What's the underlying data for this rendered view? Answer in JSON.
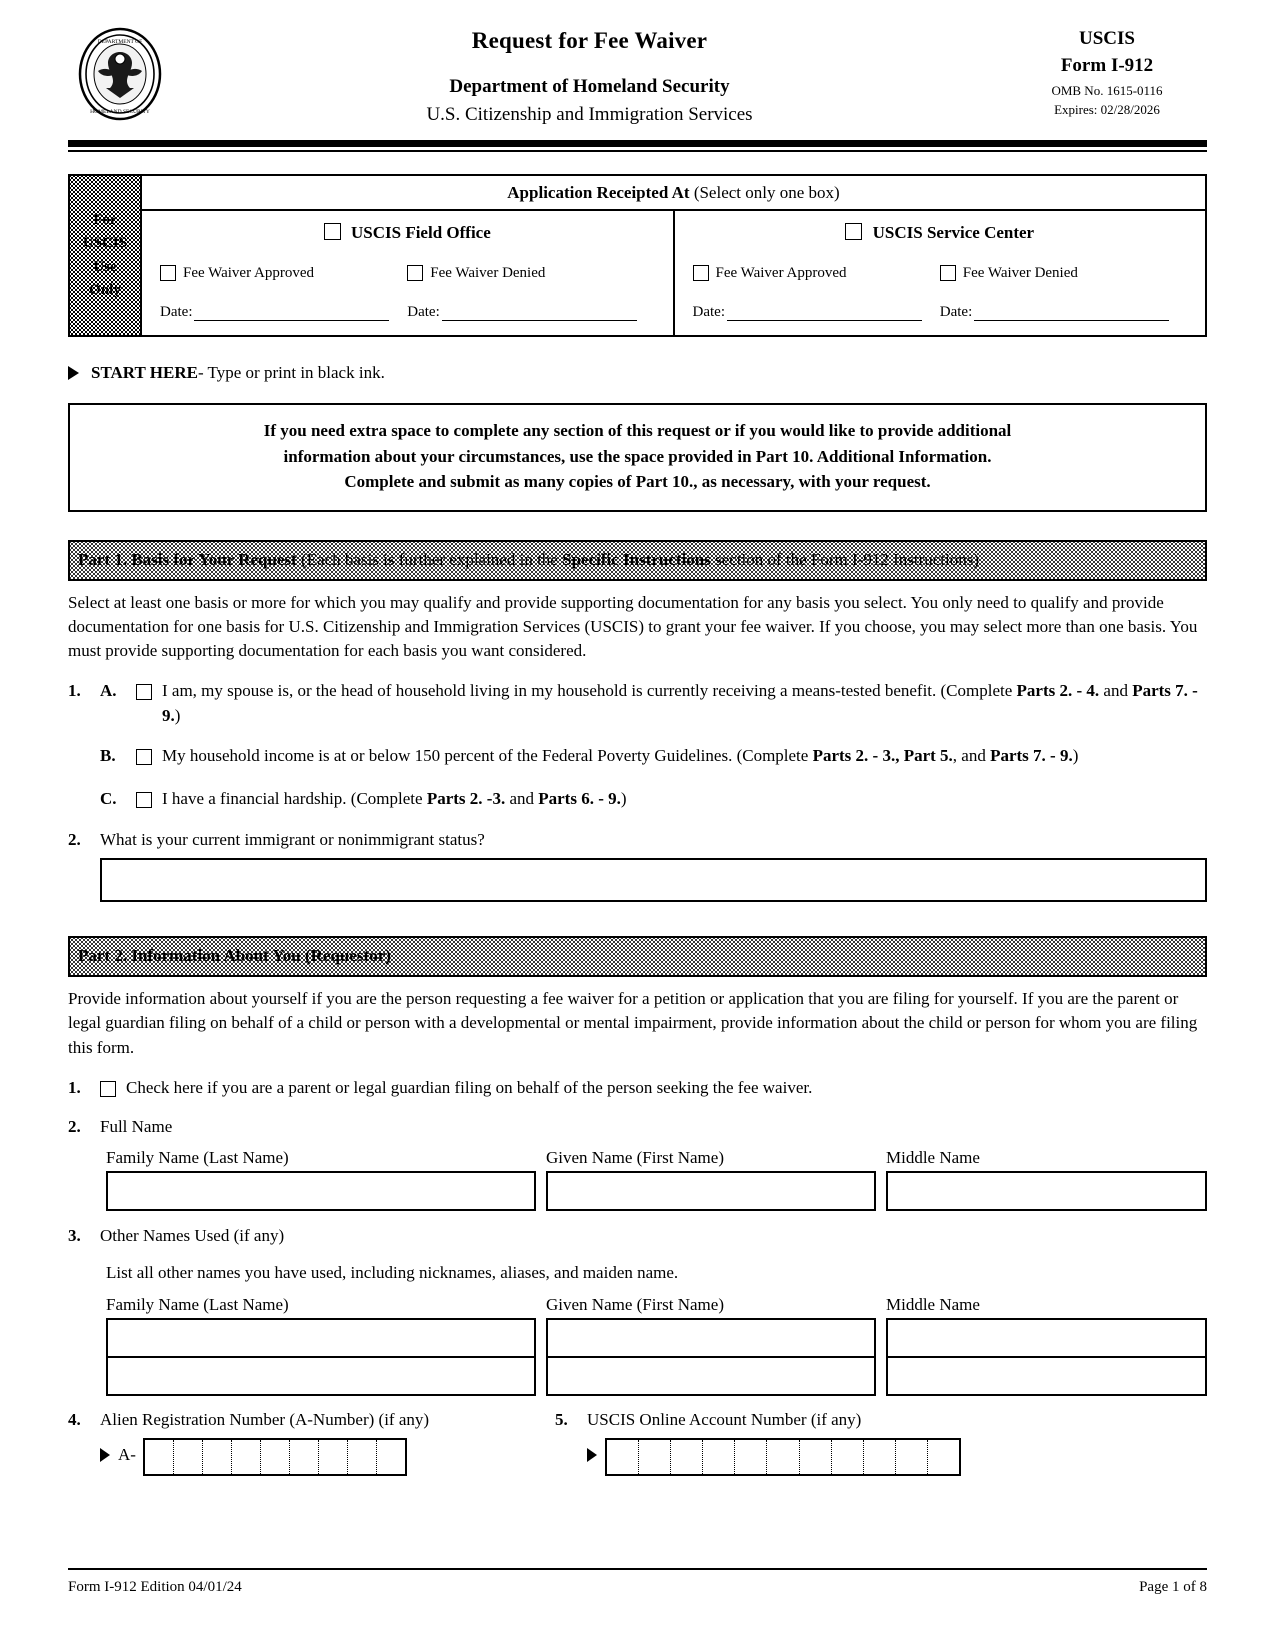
{
  "header": {
    "seal_alt": "dhs-seal",
    "title": "Request for Fee Waiver",
    "agency": "Department of Homeland Security",
    "subagency": "U.S. Citizenship and Immigration Services",
    "org": "USCIS",
    "form_number": "Form I-912",
    "omb": "OMB No. 1615-0116",
    "expires": "Expires: 02/28/2026"
  },
  "uscis_use": {
    "side_label": "For USCIS Use Only",
    "side_lines": [
      "For",
      "USCIS",
      "Use",
      "Only"
    ],
    "title_bold": "Application Receipted At",
    "title_rest": "(Select only one box)",
    "columns": [
      {
        "heading": "USCIS Field Office",
        "options": [
          "Fee Waiver Approved",
          "Fee Waiver Denied"
        ],
        "date_label": "Date:"
      },
      {
        "heading": "USCIS Service Center",
        "options": [
          "Fee Waiver Approved",
          "Fee Waiver Denied"
        ],
        "date_label": "Date:"
      }
    ]
  },
  "start_here": {
    "bold": "START HERE",
    "rest": " - Type or print in black ink."
  },
  "notice": {
    "line1": "If you need extra space to complete any section of this request or if you would like to provide additional",
    "line2": "information about your circumstances, use the space provided in Part 10. Additional Information.",
    "line3": "Complete and submit as many copies of Part 10., as necessary, with your request."
  },
  "part1": {
    "band_bold": "Part 1.  Basis for Your Request",
    "band_rest_a": " (Each basis is further explained in the ",
    "band_rest_bold": "Specific Instructions",
    "band_rest_b": " section of the Form I-912 Instructions)",
    "intro": "Select at least one basis or more for which you may qualify and provide supporting documentation for any basis you select.  You only need to qualify and provide documentation for one basis for U.S. Citizenship and Immigration Services (USCIS) to grant your fee waiver.  If you choose, you may select more than one basis.  You must provide supporting documentation for each basis you want considered.",
    "item1_number": "1.",
    "items": [
      {
        "letter": "A.",
        "text": "I am, my spouse is, or the head of household living in my household is currently receiving a means-tested benefit. (Complete ",
        "bold1": "Parts 2. - 4.",
        "mid1": " and ",
        "bold2": "Parts 7. - 9.",
        "tail": ")"
      },
      {
        "letter": "B.",
        "text": "My household income is at or below 150 percent of the Federal Poverty Guidelines.  (Complete ",
        "bold1": "Parts 2. - 3., Part 5.",
        "mid1": ", and ",
        "bold2": "Parts 7. - 9.",
        "tail": ")"
      },
      {
        "letter": "C.",
        "text": "I have a financial hardship.  (Complete ",
        "bold1": "Parts 2. -3.",
        "mid1": " and ",
        "bold2": "Parts 6. - 9.",
        "tail": ")"
      }
    ],
    "item2_number": "2.",
    "item2_label": "What is your current immigrant or nonimmigrant status?",
    "item2_value": ""
  },
  "part2": {
    "band_bold": "Part 2.  Information About You (Requestor)",
    "intro": "Provide information about yourself if you are the person requesting a fee waiver for a petition or application that you are filing for yourself.  If you are the parent or legal guardian filing on behalf of a child or person with a developmental or mental impairment, provide information about the child or person for whom you are filing this form.",
    "item1_number": "1.",
    "item1_label": "Check here if you are a parent or legal guardian filing on behalf of the person seeking the fee waiver.",
    "item2_number": "2.",
    "item2_label": "Full Name",
    "name_labels": {
      "family": "Family Name (Last Name)",
      "given": "Given Name (First Name)",
      "middle": "Middle Name"
    },
    "name_values": {
      "family": "",
      "given": "",
      "middle": ""
    },
    "item3_number": "3.",
    "item3_label": "Other Names Used (if any)",
    "item3_help": "List all other names you have used, including nicknames, aliases, and maiden name.",
    "other_names_rows": [
      {
        "family": "",
        "given": "",
        "middle": ""
      },
      {
        "family": "",
        "given": "",
        "middle": ""
      }
    ],
    "item4_number": "4.",
    "item4_label": "Alien Registration Number (A-Number) (if any)",
    "a_prefix": "A-",
    "a_number_cells": 9,
    "a_number_value": "",
    "item5_number": "5.",
    "item5_label": "USCIS Online Account Number (if any)",
    "online_account_cells": 11,
    "online_account_value": ""
  },
  "footer": {
    "left": "Form I-912   Edition   04/01/24",
    "right": "Page 1 of 8"
  }
}
